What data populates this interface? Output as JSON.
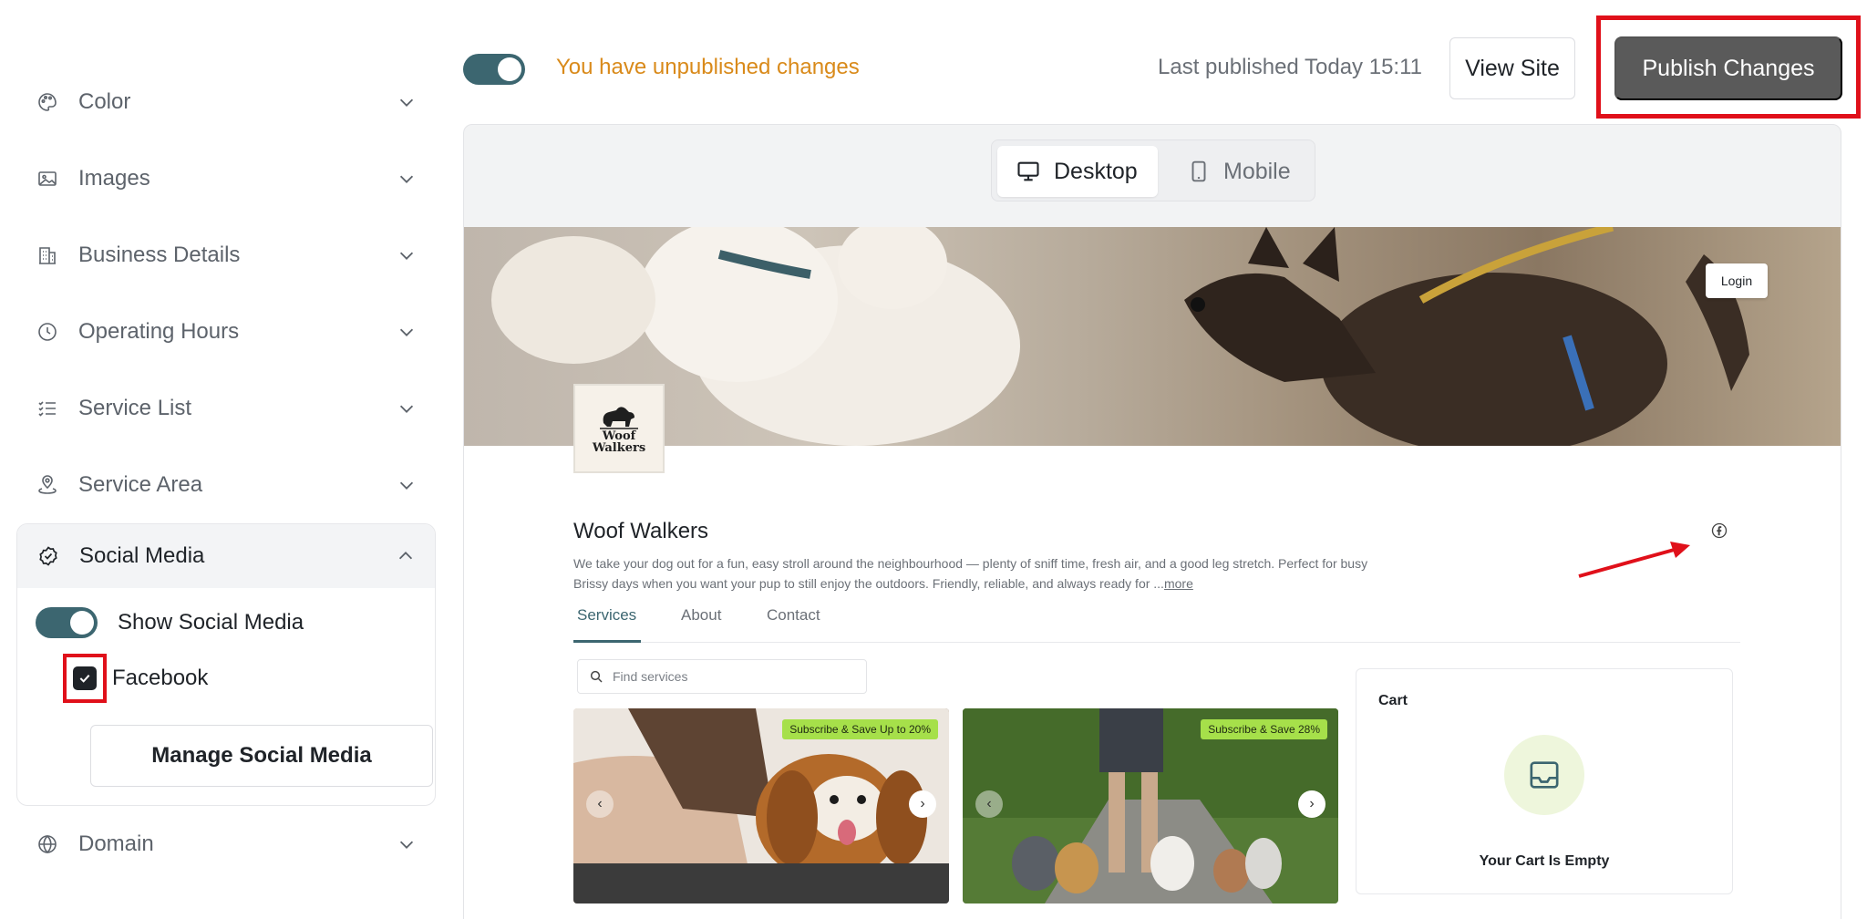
{
  "sidebar": {
    "items": [
      {
        "label": "Color",
        "icon": "palette-icon"
      },
      {
        "label": "Images",
        "icon": "image-icon"
      },
      {
        "label": "Business Details",
        "icon": "building-icon"
      },
      {
        "label": "Operating Hours",
        "icon": "clock-icon"
      },
      {
        "label": "Service List",
        "icon": "checklist-icon"
      },
      {
        "label": "Service Area",
        "icon": "map-pin-icon"
      }
    ],
    "social_media": {
      "label": "Social Media",
      "show_label": "Show Social Media",
      "show_enabled": true,
      "facebook_label": "Facebook",
      "facebook_checked": true,
      "manage_label": "Manage Social Media"
    },
    "domain": {
      "label": "Domain"
    }
  },
  "topbar": {
    "toggle_on": true,
    "unpublished": "You have unpublished changes",
    "last_published": "Last published Today 15:11",
    "view_site": "View Site",
    "publish": "Publish Changes"
  },
  "preview": {
    "device_desktop": "Desktop",
    "device_mobile": "Mobile",
    "active_device": "Desktop"
  },
  "site": {
    "login": "Login",
    "logo_line1": "Woof",
    "logo_line2": "Walkers",
    "name": "Woof Walkers",
    "description": "We take your dog out for a fun, easy stroll around the neighbourhood — plenty of sniff time, fresh air, and a good leg stretch. Perfect for busy Brissy days when you want your pup to still enjoy the outdoors. Friendly, reliable, and always ready for ...",
    "more": "more",
    "tabs": [
      "Services",
      "About",
      "Contact"
    ],
    "search_placeholder": "Find services",
    "services": [
      {
        "badge": "Subscribe & Save Up to 20%"
      },
      {
        "badge": "Subscribe & Save 28%"
      }
    ],
    "cart": {
      "title": "Cart",
      "empty": "Your Cart Is Empty"
    }
  },
  "colors": {
    "accent": "#3c6670",
    "warning": "#d98a1a",
    "publish_bg": "#5a5a5a",
    "highlight": "#e0101a",
    "badge": "#a6e04a"
  }
}
